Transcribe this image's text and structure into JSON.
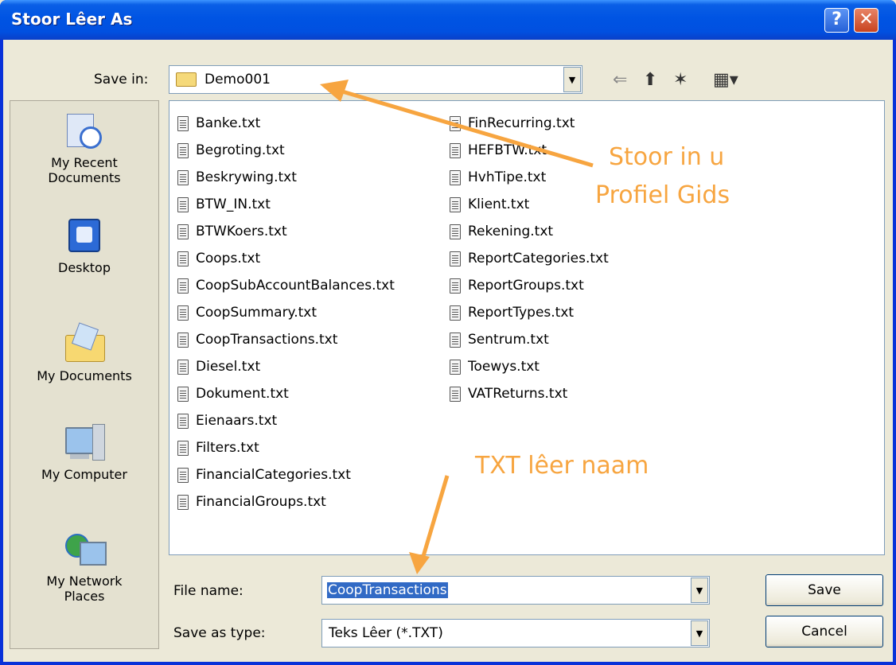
{
  "window": {
    "title": "Stoor Lêer As",
    "help_glyph": "?",
    "close_glyph": "✕"
  },
  "save_in": {
    "label": "Save in:",
    "value": "Demo001"
  },
  "toolbar": {
    "back_glyph": "⇐",
    "up_glyph": "⬆",
    "new_folder_glyph": "✶",
    "view_glyph": "▦▾"
  },
  "places": [
    {
      "label": "My Recent\nDocuments",
      "icon": "recent-documents-icon"
    },
    {
      "label": "Desktop",
      "icon": "desktop-icon"
    },
    {
      "label": "My Documents",
      "icon": "my-documents-icon"
    },
    {
      "label": "My Computer",
      "icon": "my-computer-icon"
    },
    {
      "label": "My Network\nPlaces",
      "icon": "network-places-icon"
    }
  ],
  "files_col1": [
    "Banke.txt",
    "Begroting.txt",
    "Beskrywing.txt",
    "BTW_IN.txt",
    "BTWKoers.txt",
    "Coops.txt",
    "CoopSubAccountBalances.txt",
    "CoopSummary.txt",
    "CoopTransactions.txt",
    "Diesel.txt",
    "Dokument.txt",
    "Eienaars.txt",
    "Filters.txt",
    "FinancialCategories.txt",
    "FinancialGroups.txt"
  ],
  "files_col2": [
    "FinRecurring.txt",
    "HEFBTW.txt",
    "HvhTipe.txt",
    "Klient.txt",
    "Rekening.txt",
    "ReportCategories.txt",
    "ReportGroups.txt",
    "ReportTypes.txt",
    "Sentrum.txt",
    "Toewys.txt",
    "VATReturns.txt"
  ],
  "file_name": {
    "label": "File name:",
    "value": "CoopTransactions"
  },
  "save_type": {
    "label": "Save as type:",
    "value": "Teks Lêer (*.TXT)"
  },
  "buttons": {
    "save": "Save",
    "cancel": "Cancel"
  },
  "annotations": {
    "save_in_note_line1": "Stoor in u",
    "save_in_note_line2": "Profiel Gids",
    "filename_note": "TXT lêer naam"
  },
  "colors": {
    "annotation": "#f7a540",
    "titlebar": "#0054e3"
  }
}
